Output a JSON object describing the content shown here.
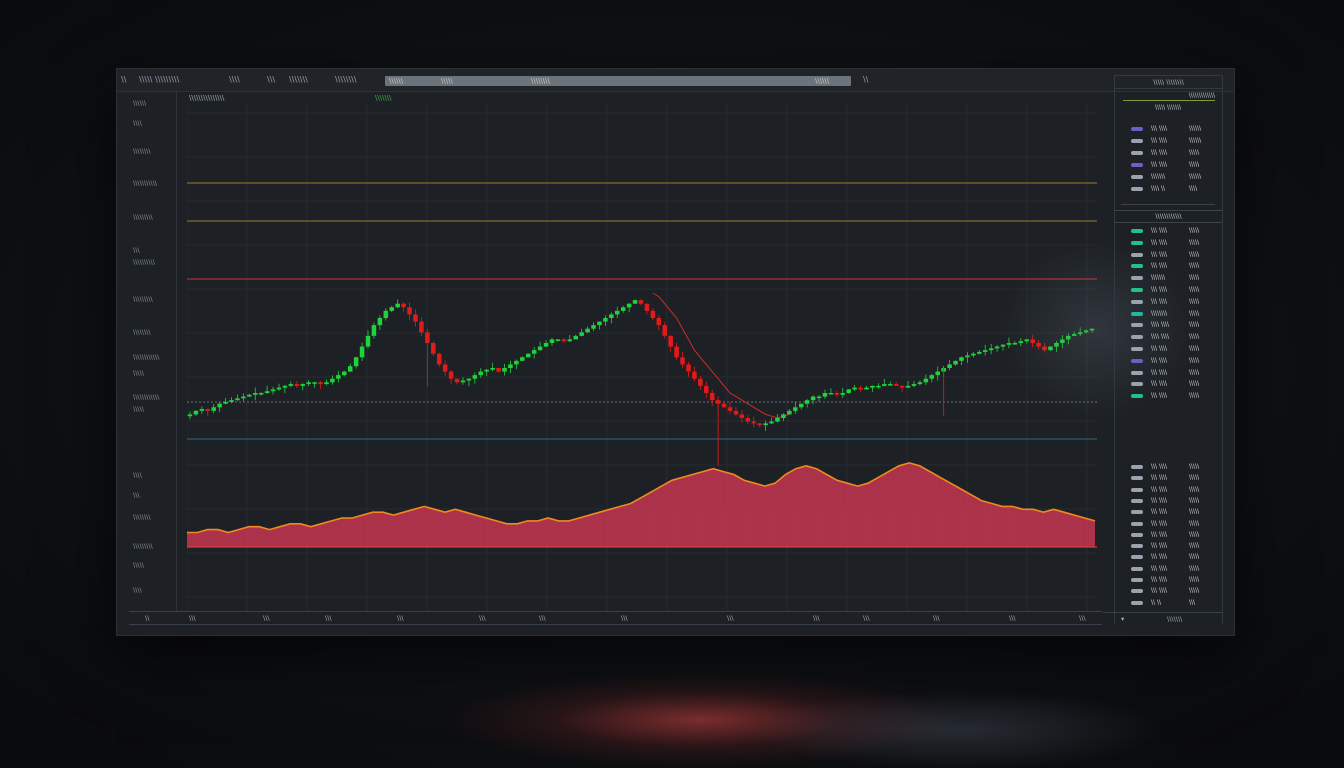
{
  "topbar": {
    "items": [
      "\\\\",
      "\\\\\\\\\\ \\\\\\\\\\\\\\\\\\",
      "\\\\\\\\",
      "\\\\\\",
      "\\\\\\\\\\\\\\",
      "\\\\\\\\\\\\\\\\",
      "\\\\"
    ],
    "search_tokens": [
      "\\\\\\\\\\\\",
      "\\\\\\\\\\",
      "\\\\\\\\\\\\\\\\",
      "\\\\\\\\\\\\"
    ]
  },
  "header": {
    "symbol_label": "\\\\\\\\\\\\\\\\\\\\\\\\\\\\\\",
    "indicator_label": "\\\\\\\\\\\\\\"
  },
  "y_axis_labels": [
    "\\\\\\\\\\\\",
    "\\\\\\\\",
    "\\\\\\\\\\\\\\\\",
    "\\\\\\\\\\\\\\\\\\\\\\",
    "\\\\\\\\\\\\\\\\\\",
    "\\\\\\",
    "\\\\\\\\\\\\\\\\\\\\",
    "\\\\\\\\\\\\\\\\\\",
    "\\\\\\\\\\\\\\\\",
    "\\\\\\\\\\\\\\\\\\\\\\\\",
    "\\\\\\\\\\",
    "\\\\\\\\\\\\\\\\\\\\\\\\",
    "\\\\\\\\\\",
    "\\\\\\\\",
    "\\\\\\",
    "\\\\\\\\\\\\\\\\",
    "\\\\\\\\\\\\\\\\\\",
    "\\\\\\\\\\",
    "\\\\\\\\"
  ],
  "x_axis_labels": [
    "\\\\",
    "\\\\\\",
    "\\\\\\",
    "\\\\\\",
    "\\\\\\",
    "\\\\\\",
    "\\\\\\",
    "\\\\\\",
    "\\\\\\",
    "\\\\\\",
    "\\\\\\",
    "\\\\\\",
    "\\\\\\",
    "\\\\\\",
    "\\\\\\"
  ],
  "orderbook": {
    "header": "\\\\\\\\\\ \\\\\\\\\\\\\\\\",
    "title": "\\\\\\\\\\\\\\\\\\\\\\\\\\",
    "subtitle": "\\\\\\\\\\ \\\\\\\\\\\\\\",
    "mid_label": "\\\\\\\\\\\\\\\\\\\\\\\\",
    "footer": "\\\\\\\\\\\\\\",
    "rows_top": [
      {
        "a": "\\\\\\ \\\\\\\\",
        "b": "\\\\\\\\\\\\",
        "pill": "#6a5fc9"
      },
      {
        "a": "\\\\\\ \\\\\\\\",
        "b": "\\\\\\\\\\\\",
        "pill": "#9aa3ad"
      },
      {
        "a": "\\\\\\ \\\\\\\\",
        "b": "\\\\\\\\\\",
        "pill": "#9aa3ad"
      },
      {
        "a": "\\\\\\ \\\\\\\\",
        "b": "\\\\\\\\\\",
        "pill": "#6a5fc9"
      },
      {
        "a": "\\\\\\\\\\\\\\",
        "b": "\\\\\\\\\\\\",
        "pill": "#9aa3ad"
      },
      {
        "a": "\\\\\\\\ \\\\",
        "b": "\\\\\\\\",
        "pill": "#9aa3ad"
      }
    ],
    "rows_mid": [
      {
        "a": "\\\\\\ \\\\\\\\",
        "b": "\\\\\\\\\\",
        "pill": "#22c08a"
      },
      {
        "a": "\\\\\\ \\\\\\\\",
        "b": "\\\\\\\\\\",
        "pill": "#22c08a"
      },
      {
        "a": "\\\\\\ \\\\\\\\",
        "b": "\\\\\\\\\\",
        "pill": "#9aa3ad"
      },
      {
        "a": "\\\\\\ \\\\\\\\",
        "b": "\\\\\\\\\\",
        "pill": "#22c08a"
      },
      {
        "a": "\\\\\\\\\\\\\\",
        "b": "\\\\\\\\\\",
        "pill": "#9aa3ad"
      },
      {
        "a": "\\\\\\ \\\\\\\\",
        "b": "\\\\\\\\\\",
        "pill": "#22c08a"
      },
      {
        "a": "\\\\\\ \\\\\\\\",
        "b": "\\\\\\\\\\",
        "pill": "#9aa3ad"
      },
      {
        "a": "\\\\\\\\\\\\\\\\",
        "b": "\\\\\\\\\\",
        "pill": "#1fb8a0"
      },
      {
        "a": "\\\\\\\\ \\\\\\\\",
        "b": "\\\\\\\\\\",
        "pill": "#9aa3ad"
      },
      {
        "a": "\\\\\\\\ \\\\\\\\",
        "b": "\\\\\\\\\\",
        "pill": "#9aa3ad"
      },
      {
        "a": "\\\\\\ \\\\\\\\",
        "b": "\\\\\\\\\\",
        "pill": "#9aa3ad"
      },
      {
        "a": "\\\\\\ \\\\\\\\",
        "b": "\\\\\\\\\\",
        "pill": "#6a5fc9"
      },
      {
        "a": "\\\\\\ \\\\\\\\",
        "b": "\\\\\\\\\\",
        "pill": "#9aa3ad"
      },
      {
        "a": "\\\\\\ \\\\\\\\",
        "b": "\\\\\\\\\\",
        "pill": "#9aa3ad"
      },
      {
        "a": "\\\\\\ \\\\\\\\",
        "b": "\\\\\\\\\\",
        "pill": "#22c08a"
      }
    ],
    "rows_bottom": [
      {
        "a": "\\\\\\ \\\\\\\\",
        "b": "\\\\\\\\\\",
        "pill": "#9aa3ad"
      },
      {
        "a": "\\\\\\ \\\\\\\\",
        "b": "\\\\\\\\\\",
        "pill": "#9aa3ad"
      },
      {
        "a": "\\\\\\ \\\\\\\\",
        "b": "\\\\\\\\\\",
        "pill": "#9aa3ad"
      },
      {
        "a": "\\\\\\ \\\\\\\\",
        "b": "\\\\\\\\\\",
        "pill": "#9aa3ad"
      },
      {
        "a": "\\\\\\ \\\\\\\\",
        "b": "\\\\\\\\\\",
        "pill": "#9aa3ad"
      },
      {
        "a": "\\\\\\ \\\\\\\\",
        "b": "\\\\\\\\\\",
        "pill": "#9aa3ad"
      },
      {
        "a": "\\\\\\ \\\\\\\\",
        "b": "\\\\\\\\\\",
        "pill": "#9aa3ad"
      },
      {
        "a": "\\\\\\ \\\\\\\\",
        "b": "\\\\\\\\\\",
        "pill": "#9aa3ad"
      },
      {
        "a": "\\\\\\ \\\\\\\\",
        "b": "\\\\\\\\\\",
        "pill": "#9aa3ad"
      },
      {
        "a": "\\\\\\ \\\\\\\\",
        "b": "\\\\\\\\\\",
        "pill": "#9aa3ad"
      },
      {
        "a": "\\\\\\ \\\\\\\\",
        "b": "\\\\\\\\\\",
        "pill": "#9aa3ad"
      },
      {
        "a": "\\\\\\ \\\\\\\\",
        "b": "\\\\\\\\\\",
        "pill": "#9aa3ad"
      },
      {
        "a": "\\\\ \\\\",
        "b": "\\\\\\",
        "pill": "#9aa3ad"
      }
    ]
  },
  "colors": {
    "up": "#1fd43a",
    "down": "#e31a1a",
    "volume_fill": "#c2344f",
    "volume_edge": "#f08a1e",
    "line_gold": "#9c7d2a",
    "line_red": "#c9343c",
    "line_teal": "#2e6a78",
    "line_dotted": "#6b737d",
    "ma_line": "#d12a2a"
  },
  "chart_data": {
    "type": "candlestick",
    "closes": [
      100,
      101,
      101.5,
      101,
      102,
      103,
      103.5,
      104,
      104.5,
      105,
      105.5,
      106,
      106,
      106.5,
      107,
      107.5,
      108,
      108.5,
      108,
      108.5,
      109,
      109,
      108.5,
      109,
      110,
      111,
      112,
      113.5,
      116,
      119,
      122,
      125,
      127,
      129,
      130,
      131,
      130,
      128,
      126,
      123,
      120,
      117,
      114,
      112,
      110,
      109,
      109.5,
      110,
      111,
      112,
      112.5,
      113,
      112,
      113,
      114,
      115,
      116,
      117,
      118,
      119,
      120,
      121,
      121,
      120.5,
      121,
      122,
      123,
      124,
      125,
      126,
      127,
      128,
      129,
      130,
      131,
      132,
      131,
      129,
      127,
      125,
      122,
      119,
      116,
      114,
      112,
      110,
      108,
      106,
      104,
      103,
      102,
      101,
      100,
      99,
      98,
      97.5,
      97,
      97.5,
      98,
      99,
      100,
      101,
      102,
      103,
      104,
      105,
      105,
      106,
      106,
      105.5,
      106,
      107,
      107.5,
      107,
      107.5,
      108,
      108,
      108.5,
      108.5,
      108,
      107.5,
      108,
      108.5,
      109,
      110,
      111,
      112,
      113,
      114,
      115,
      116,
      116.5,
      117,
      117.5,
      118,
      118.5,
      119,
      119.5,
      120,
      120,
      120.5,
      121,
      120,
      119,
      118,
      119,
      120,
      121,
      122,
      122.5,
      123,
      123.5,
      124
    ],
    "volume": [
      5,
      5,
      6,
      6,
      5,
      6,
      7,
      7,
      6,
      7,
      8,
      8,
      7,
      8,
      9,
      10,
      10,
      11,
      12,
      12,
      11,
      12,
      13,
      14,
      13,
      12,
      13,
      12,
      11,
      10,
      9,
      8,
      8,
      9,
      9,
      10,
      9,
      9,
      10,
      11,
      12,
      13,
      14,
      15,
      17,
      19,
      21,
      23,
      24,
      25,
      26,
      27,
      26,
      25,
      23,
      22,
      21,
      22,
      25,
      27,
      28,
      27,
      25,
      23,
      22,
      21,
      22,
      24,
      26,
      28,
      29,
      28,
      26,
      24,
      22,
      20,
      18,
      16,
      15,
      14,
      14,
      13,
      13,
      12,
      13,
      12,
      11,
      10,
      9
    ]
  }
}
